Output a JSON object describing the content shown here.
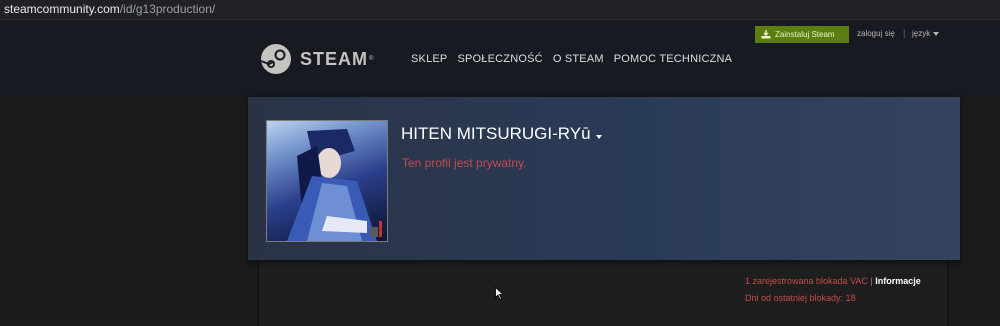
{
  "browser": {
    "url_domain": "steamcommunity.com",
    "url_path": "/id/g13production/"
  },
  "header": {
    "logo_text": "STEAM",
    "nav": [
      "SKLEP",
      "SPOŁECZNOŚĆ",
      "O STEAM",
      "POMOC TECHNICZNA"
    ],
    "install_label": "Zainstaluj Steam",
    "login_label": "zaloguj się",
    "separator": "|",
    "language_label": "język"
  },
  "profile": {
    "persona_name": "HITEN MITSURUGI-RYū",
    "private_text": "Ten profil jest prywatny."
  },
  "bans": {
    "vac_text": "1 zarejestrowana blokada VAC",
    "separator": "|",
    "info_link": "Informacje",
    "days_text": "Dni od ostatniej blokady: 18"
  },
  "colors": {
    "header_bg": "#171a21",
    "install_green": "#5c7e10",
    "private_red": "#c34b4b"
  }
}
